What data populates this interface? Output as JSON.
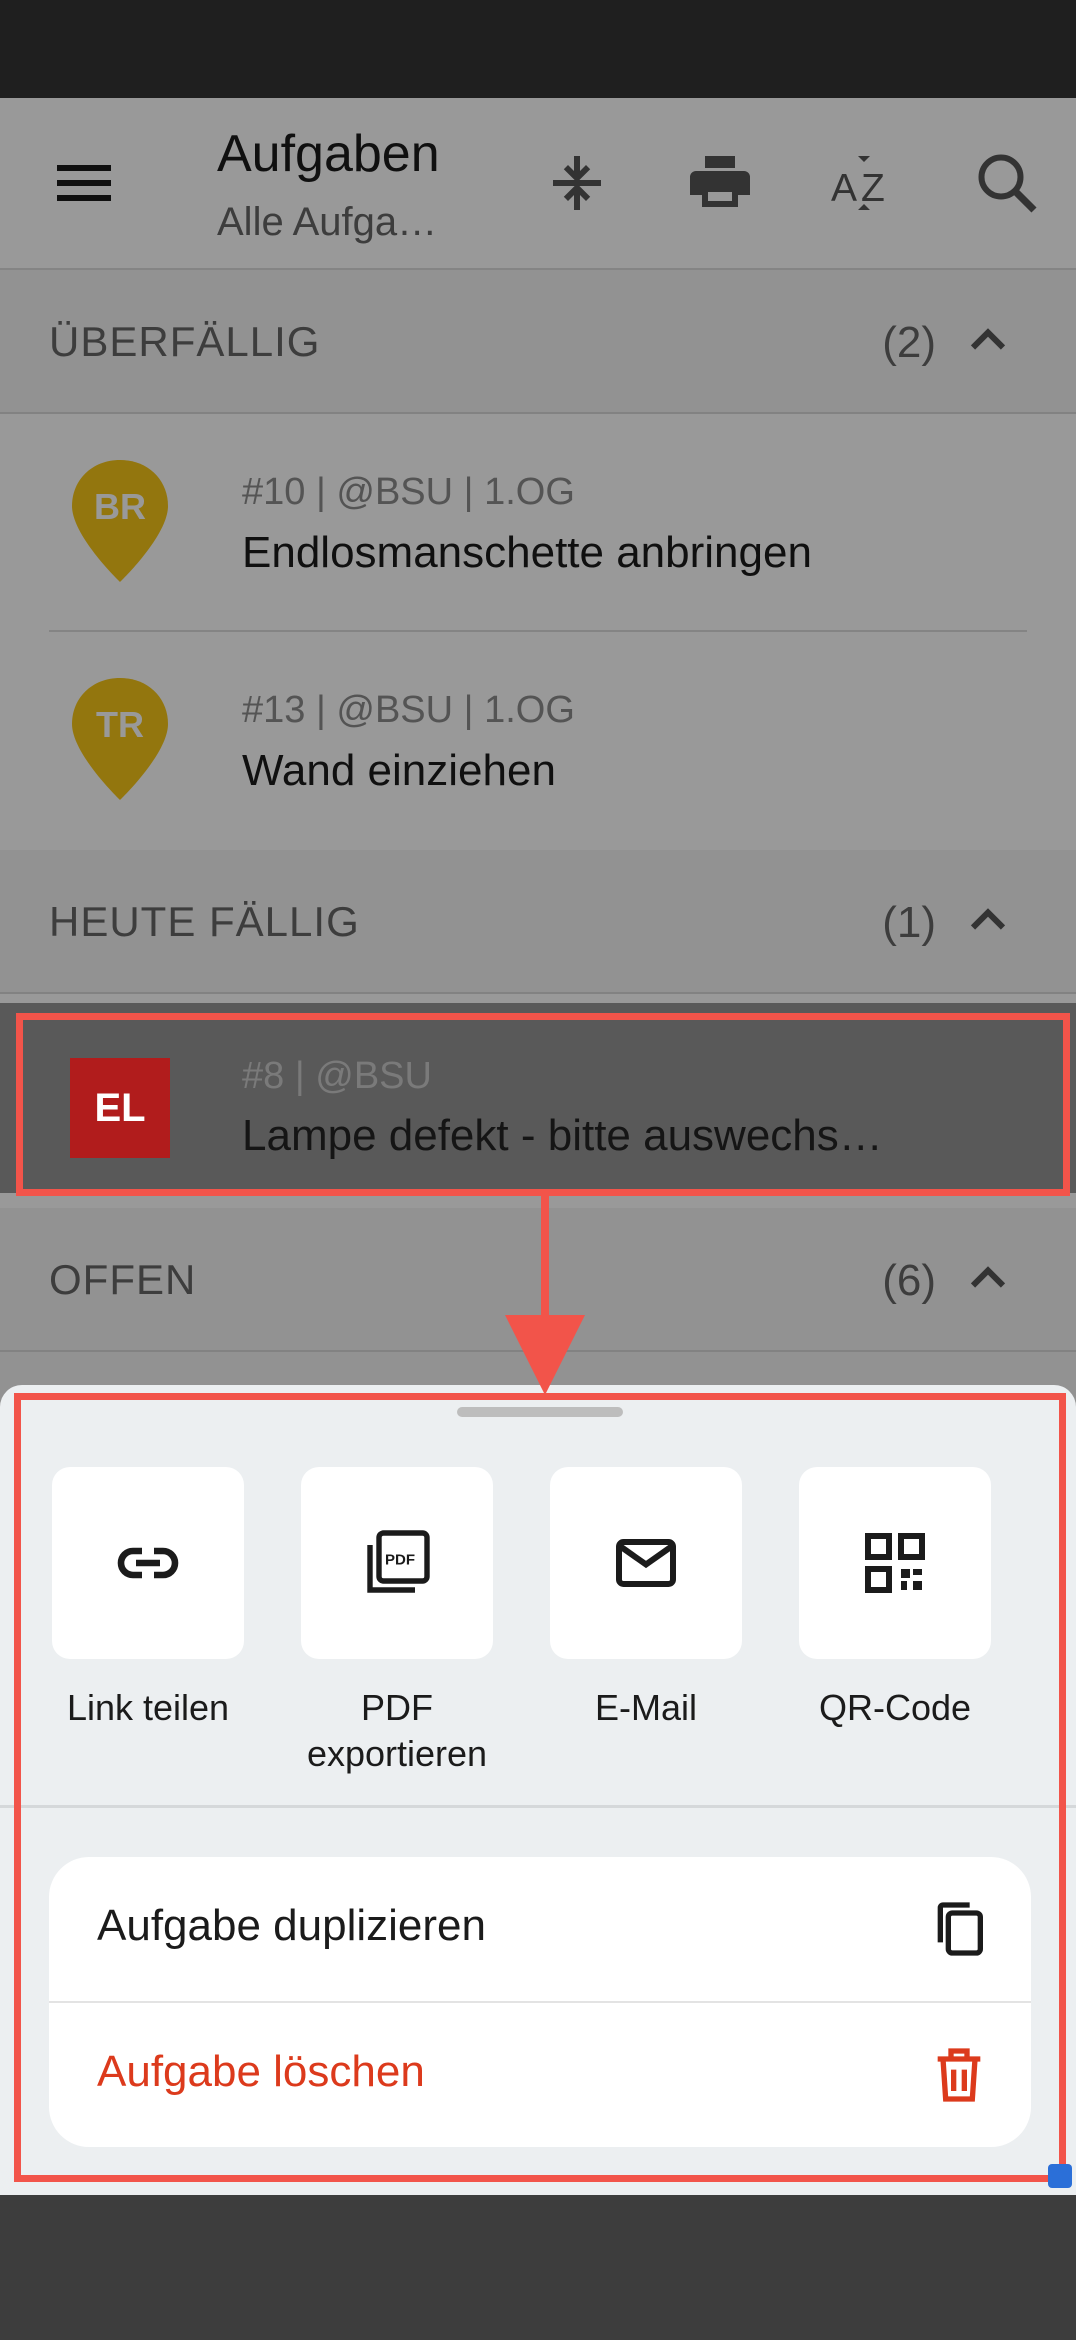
{
  "toolbar": {
    "title": "Aufgaben",
    "subtitle": "Alle Aufga…"
  },
  "sections": {
    "overdue": {
      "label": "ÜBERFÄLLIG",
      "count": "(2)"
    },
    "today": {
      "label": "HEUTE FÄLLIG",
      "count": "(1)"
    },
    "open": {
      "label": "OFFEN",
      "count": "(6)"
    }
  },
  "tasks": {
    "overdue": [
      {
        "badge": "BR",
        "meta": "#10 | @BSU | 1.OG",
        "title": "Endlosmanschette anbringen"
      },
      {
        "badge": "TR",
        "meta": "#13 | @BSU | 1.OG",
        "title": "Wand einziehen"
      }
    ],
    "today": [
      {
        "badge": "EL",
        "meta": "#8 | @BSU",
        "title": "Lampe defekt - bitte auswechs…"
      }
    ]
  },
  "sheet": {
    "actions": [
      {
        "label": "Link teilen",
        "icon": "link-icon"
      },
      {
        "label": "PDF exportieren",
        "icon": "pdf-icon"
      },
      {
        "label": "E-Mail",
        "icon": "mail-icon"
      },
      {
        "label": "QR-Code",
        "icon": "qr-code-icon"
      }
    ],
    "duplicate_label": "Aufgabe duplizieren",
    "delete_label": "Aufgabe löschen"
  },
  "colors": {
    "pin_yellow": "#f5c518",
    "badge_red": "#b11c1c",
    "delete_red": "#dc3a1c",
    "highlight": "#f2544a"
  }
}
